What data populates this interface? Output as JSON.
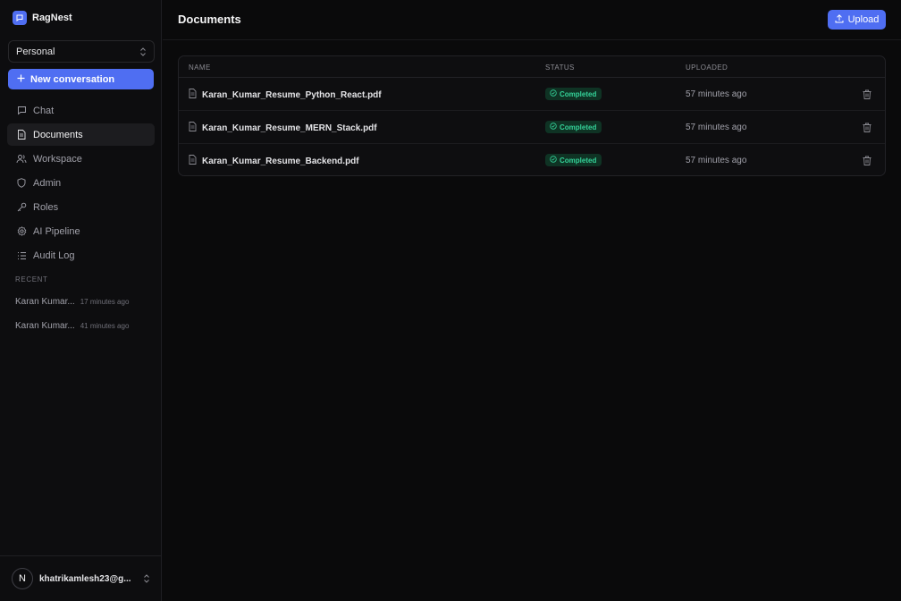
{
  "brand": {
    "name": "RagNest"
  },
  "workspace": {
    "selected": "Personal"
  },
  "new_conversation_label": "New conversation",
  "nav": {
    "items": [
      {
        "label": "Chat",
        "icon": "chat-bubble-icon",
        "active": false
      },
      {
        "label": "Documents",
        "icon": "document-icon",
        "active": true
      },
      {
        "label": "Workspace",
        "icon": "users-icon",
        "active": false
      },
      {
        "label": "Admin",
        "icon": "shield-icon",
        "active": false
      },
      {
        "label": "Roles",
        "icon": "key-icon",
        "active": false
      },
      {
        "label": "AI Pipeline",
        "icon": "gear-icon",
        "active": false
      },
      {
        "label": "Audit Log",
        "icon": "list-icon",
        "active": false
      }
    ]
  },
  "recent": {
    "title": "RECENT",
    "items": [
      {
        "title": "Karan Kumar...",
        "time": "17 minutes ago"
      },
      {
        "title": "Karan Kumar...",
        "time": "41 minutes ago"
      }
    ]
  },
  "user": {
    "initial": "N",
    "email": "khatrikamlesh23@g..."
  },
  "page": {
    "title": "Documents",
    "upload_label": "Upload"
  },
  "table": {
    "headers": {
      "name": "NAME",
      "status": "STATUS",
      "uploaded": "UPLOADED"
    },
    "rows": [
      {
        "name": "Karan_Kumar_Resume_Python_React.pdf",
        "status": "Completed",
        "uploaded": "57 minutes ago"
      },
      {
        "name": "Karan_Kumar_Resume_MERN_Stack.pdf",
        "status": "Completed",
        "uploaded": "57 minutes ago"
      },
      {
        "name": "Karan_Kumar_Resume_Backend.pdf",
        "status": "Completed",
        "uploaded": "57 minutes ago"
      }
    ]
  },
  "colors": {
    "accent": "#4f6ef2",
    "status_completed_bg": "#0f3324",
    "status_completed_fg": "#34d399",
    "background": "#0a0a0b"
  }
}
